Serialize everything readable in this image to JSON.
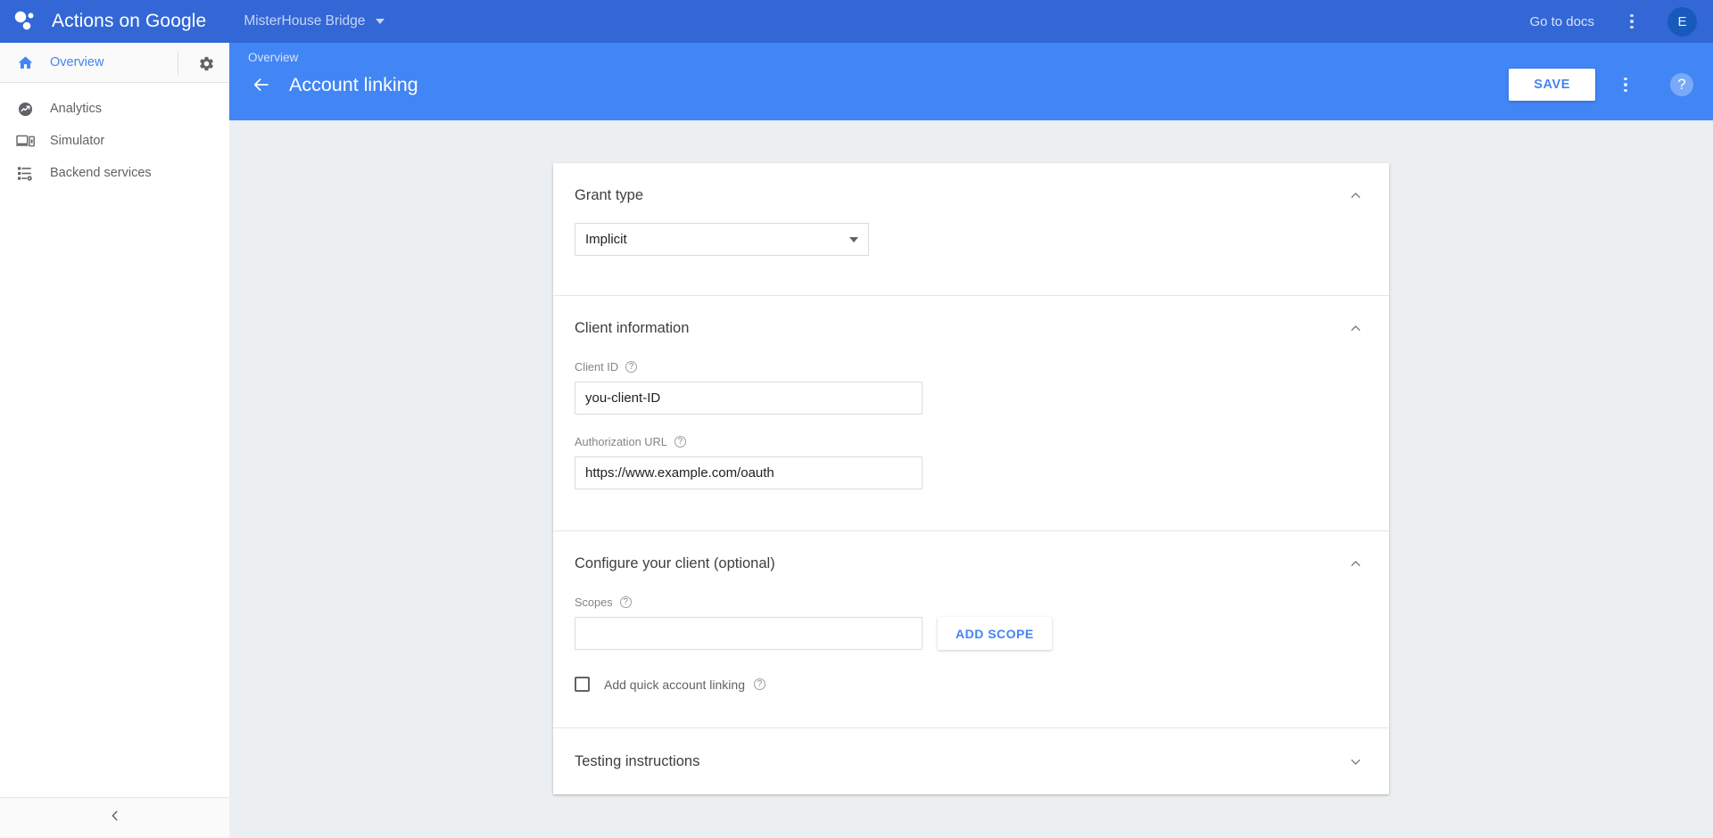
{
  "topbar": {
    "logo_icon": "google-assistant-dots-logo",
    "app_title": "Actions on Google",
    "project_name": "MisterHouse Bridge",
    "project_caret_icon": "caret-down-icon",
    "go_to_docs": "Go to docs",
    "overflow_icon": "kebab-menu-icon",
    "avatar_initial": "E"
  },
  "sidebar": {
    "overview": {
      "label": "Overview",
      "icon": "home-icon"
    },
    "settings_icon": "gear-icon",
    "items": [
      {
        "label": "Analytics",
        "icon": "analytics-icon"
      },
      {
        "label": "Simulator",
        "icon": "simulator-icon"
      },
      {
        "label": "Backend services",
        "icon": "backend-services-icon"
      }
    ],
    "collapse_icon": "chevron-left-icon"
  },
  "page_header": {
    "breadcrumb": "Overview",
    "back_icon": "arrow-left-icon",
    "title": "Account linking",
    "save_label": "SAVE",
    "overflow_icon": "kebab-menu-icon",
    "help_icon": "?"
  },
  "sections": {
    "grant_type": {
      "title": "Grant type",
      "chevron_icon": "chevron-up-icon",
      "select_value": "Implicit",
      "select_caret_icon": "caret-down-icon"
    },
    "client_information": {
      "title": "Client information",
      "chevron_icon": "chevron-up-icon",
      "client_id": {
        "label": "Client ID",
        "help_icon": "?",
        "value": "you-client-ID",
        "placeholder": ""
      },
      "authorization_url": {
        "label": "Authorization URL",
        "help_icon": "?",
        "value": "https://www.example.com/oauth",
        "placeholder": ""
      }
    },
    "configure_client": {
      "title": "Configure your client (optional)",
      "chevron_icon": "chevron-up-icon",
      "scopes": {
        "label": "Scopes",
        "help_icon": "?",
        "value": "",
        "placeholder": ""
      },
      "add_scope_label": "ADD SCOPE",
      "quick_linking": {
        "label": "Add quick account linking",
        "help_icon": "?",
        "checked": false
      }
    },
    "testing_instructions": {
      "title": "Testing instructions",
      "chevron_icon": "chevron-down-icon"
    }
  },
  "colors": {
    "topbar_blue": "#3367d6",
    "header_blue": "#4285f4",
    "accent_blue": "#4285f4",
    "content_bg": "#eceff1"
  }
}
